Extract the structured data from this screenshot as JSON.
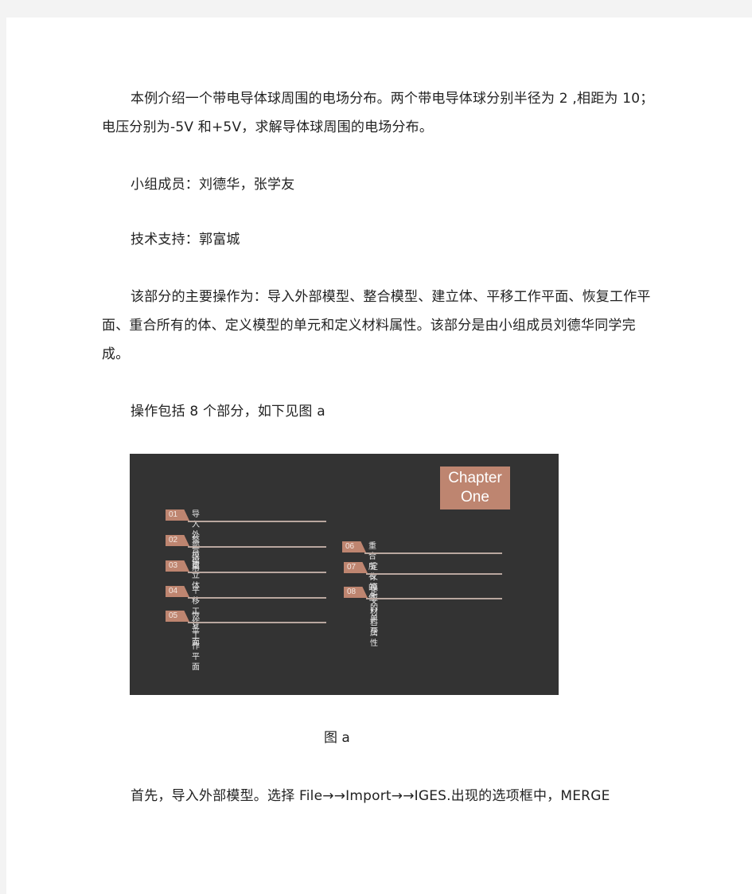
{
  "paragraphs": {
    "intro": "本例介绍一个带电导体球周围的电场分布。两个带电导体球分别半径为 2 ,相距为 10；电压分别为-5V 和+5V，求解导体球周围的电场分布。",
    "members": "小组成员：刘德华，张学友",
    "support": "技术支持：郭富城",
    "main_ops": "该部分的主要操作为：导入外部模型、整合模型、建立体、平移工作平面、恢复工作平面、重合所有的体、定义模型的单元和定义材料属性。该部分是由小组成员刘德华同学完成。",
    "ops_count": "操作包括 8 个部分，如下见图 a",
    "first_step": "首先，导入外部模型。选择 File→→Import→→IGES.出现的选项框中，MERGE"
  },
  "figure": {
    "chapter_line1": "Chapter",
    "chapter_line2": "One",
    "items": [
      {
        "num": "01",
        "label": "导入外部模型"
      },
      {
        "num": "02",
        "label": "整合模型"
      },
      {
        "num": "03",
        "label": "建立体"
      },
      {
        "num": "04",
        "label": "平移工作平面"
      },
      {
        "num": "05",
        "label": "恢复工作平面"
      },
      {
        "num": "06",
        "label": "重合所有的体"
      },
      {
        "num": "07",
        "label": "定义模型的单元"
      },
      {
        "num": "08",
        "label": "定义材料属性"
      }
    ],
    "caption": "图 a",
    "colors": {
      "background": "#333333",
      "accent": "#be8570",
      "rule": "#b9a79f"
    }
  }
}
